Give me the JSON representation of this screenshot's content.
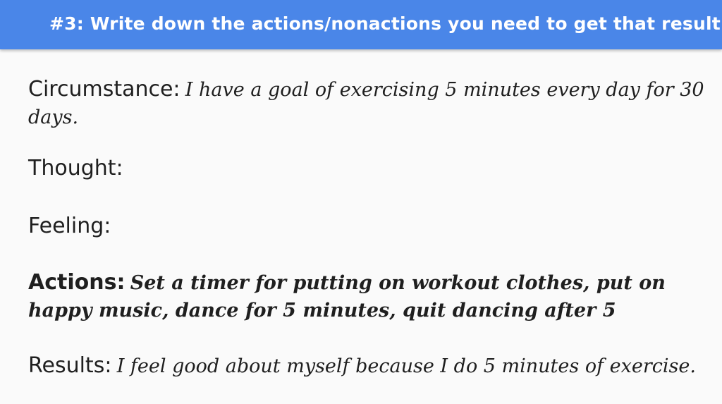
{
  "header": {
    "title": "#3: Write down the actions/nonactions you need to get that result."
  },
  "model": {
    "circumstance": {
      "label": "Circumstance:",
      "value": "I have a goal of exercising 5 minutes every day for 30 days."
    },
    "thought": {
      "label": "Thought:",
      "value": ""
    },
    "feeling": {
      "label": "Feeling:",
      "value": ""
    },
    "actions": {
      "label": "Actions:",
      "value": "Set a timer for putting on workout clothes, put on happy music, dance for 5 minutes, quit dancing after 5"
    },
    "results": {
      "label": "Results:",
      "value": "I feel good about myself because I do 5 minutes of exercise."
    }
  },
  "colors": {
    "header_background": "#4a86e8",
    "header_text": "#ffffff",
    "page_background": "#fafafa",
    "body_text": "#1f1f1f"
  }
}
